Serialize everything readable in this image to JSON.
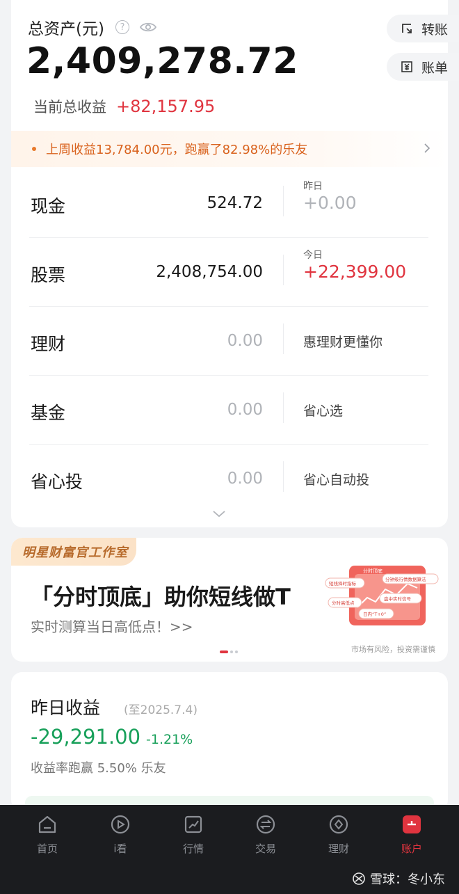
{
  "assets": {
    "title": "总资产(元)",
    "total": "2,409,278.72",
    "profit_label": "当前总收益",
    "profit_value": "+82,157.95",
    "transfer_label": "转账",
    "bill_label": "账单"
  },
  "notice": {
    "text": "上周收益13,784.00元，跑赢了82.98%的乐友"
  },
  "holdings": [
    {
      "name": "现金",
      "amount": "524.72",
      "side_label": "昨日",
      "side_value": "+0.00",
      "side_tip": ""
    },
    {
      "name": "股票",
      "amount": "2,408,754.00",
      "side_label": "今日",
      "side_value": "+22,399.00",
      "side_tip": ""
    },
    {
      "name": "理财",
      "amount": "0.00",
      "side_label": "",
      "side_value": "",
      "side_tip": "惠理财更懂你"
    },
    {
      "name": "基金",
      "amount": "0.00",
      "side_label": "",
      "side_value": "",
      "side_tip": "省心选"
    },
    {
      "name": "省心投",
      "amount": "0.00",
      "side_label": "",
      "side_value": "",
      "side_tip": "省心自动投"
    }
  ],
  "banner": {
    "tag": "明星财富官工作室",
    "headline": "「分时顶底」助你短线做T",
    "subline": "实时测算当日高低点！>>",
    "risk": "市场有风险，投资需谨慎",
    "illus_labels": [
      "分时顶底",
      "短线择时指标",
      "分钟级行情数据算法",
      "分时高低点",
      "盘中实时信号",
      "日内“T+0”"
    ]
  },
  "yesterday": {
    "title": "昨日收益",
    "date": "(至2025.7.4)",
    "value": "-29,291.00",
    "percent": "-1.21%",
    "beat": "收益率跑赢 5.50% 乐友"
  },
  "tabs": [
    {
      "label": "首页",
      "icon": "home-icon"
    },
    {
      "label": "i看",
      "icon": "play-icon"
    },
    {
      "label": "行情",
      "icon": "chart-icon"
    },
    {
      "label": "交易",
      "icon": "exchange-icon"
    },
    {
      "label": "理财",
      "icon": "wealth-icon"
    },
    {
      "label": "账户",
      "icon": "account-icon"
    }
  ],
  "watermark": "雪球：冬小东",
  "colors": {
    "red": "#e0343f",
    "green": "#18a05a",
    "orange": "#d9621d",
    "nav_bg": "#1b1c1f"
  }
}
